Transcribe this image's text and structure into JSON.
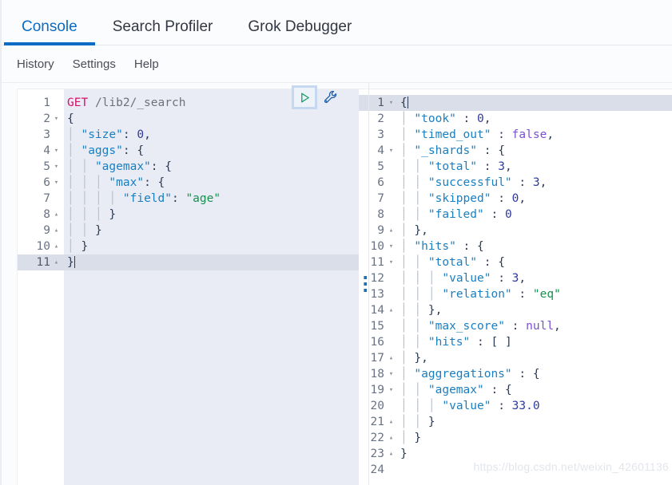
{
  "tabs": [
    {
      "label": "Console",
      "active": true
    },
    {
      "label": "Search Profiler",
      "active": false
    },
    {
      "label": "Grok Debugger",
      "active": false
    }
  ],
  "menu": [
    {
      "label": "History"
    },
    {
      "label": "Settings"
    },
    {
      "label": "Help"
    }
  ],
  "toolbar": {
    "play_icon": "play-triangle-icon",
    "wrench_icon": "wrench-icon",
    "play_title": "Click to send request",
    "wrench_title": "Open documentation / options"
  },
  "request_editor": {
    "accent_active_line": "#d9dee9",
    "background": "#e9ecf4",
    "active_line": 11,
    "lines": [
      {
        "n": 1,
        "fold": "",
        "text": "GET /lib2/_search"
      },
      {
        "n": 2,
        "fold": "▾",
        "text": "{"
      },
      {
        "n": 3,
        "fold": "",
        "text": "  \"size\": 0,"
      },
      {
        "n": 4,
        "fold": "▾",
        "text": "  \"aggs\": {"
      },
      {
        "n": 5,
        "fold": "▾",
        "text": "    \"agemax\": {"
      },
      {
        "n": 6,
        "fold": "▾",
        "text": "      \"max\": {"
      },
      {
        "n": 7,
        "fold": "",
        "text": "        \"field\": \"age\""
      },
      {
        "n": 8,
        "fold": "▴",
        "text": "      }"
      },
      {
        "n": 9,
        "fold": "▴",
        "text": "    }"
      },
      {
        "n": 10,
        "fold": "▴",
        "text": "  }"
      },
      {
        "n": 11,
        "fold": "▴",
        "text": "}"
      }
    ]
  },
  "response_editor": {
    "background": "#ffffff",
    "active_line": 1,
    "lines": [
      {
        "n": 1,
        "fold": "▾",
        "text": "{"
      },
      {
        "n": 2,
        "fold": "",
        "text": "  \"took\" : 0,"
      },
      {
        "n": 3,
        "fold": "",
        "text": "  \"timed_out\" : false,"
      },
      {
        "n": 4,
        "fold": "▾",
        "text": "  \"_shards\" : {"
      },
      {
        "n": 5,
        "fold": "",
        "text": "    \"total\" : 3,"
      },
      {
        "n": 6,
        "fold": "",
        "text": "    \"successful\" : 3,"
      },
      {
        "n": 7,
        "fold": "",
        "text": "    \"skipped\" : 0,"
      },
      {
        "n": 8,
        "fold": "",
        "text": "    \"failed\" : 0"
      },
      {
        "n": 9,
        "fold": "▴",
        "text": "  },"
      },
      {
        "n": 10,
        "fold": "▾",
        "text": "  \"hits\" : {"
      },
      {
        "n": 11,
        "fold": "▾",
        "text": "    \"total\" : {"
      },
      {
        "n": 12,
        "fold": "",
        "text": "      \"value\" : 3,"
      },
      {
        "n": 13,
        "fold": "",
        "text": "      \"relation\" : \"eq\""
      },
      {
        "n": 14,
        "fold": "▴",
        "text": "    },"
      },
      {
        "n": 15,
        "fold": "",
        "text": "    \"max_score\" : null,"
      },
      {
        "n": 16,
        "fold": "",
        "text": "    \"hits\" : [ ]"
      },
      {
        "n": 17,
        "fold": "▴",
        "text": "  },"
      },
      {
        "n": 18,
        "fold": "▾",
        "text": "  \"aggregations\" : {"
      },
      {
        "n": 19,
        "fold": "▾",
        "text": "    \"agemax\" : {"
      },
      {
        "n": 20,
        "fold": "",
        "text": "      \"value\" : 33.0"
      },
      {
        "n": 21,
        "fold": "▴",
        "text": "    }"
      },
      {
        "n": 22,
        "fold": "▴",
        "text": "  }"
      },
      {
        "n": 23,
        "fold": "▴",
        "text": "}"
      },
      {
        "n": 24,
        "fold": "",
        "text": ""
      }
    ]
  },
  "divider": {
    "grip_icon": "drag-handle-icon"
  },
  "watermark": {
    "text": "https://blog.csdn.net/weixin_42601136"
  },
  "colors": {
    "accent": "#0a6cc4",
    "method": "#d9106d",
    "string": "#18914f",
    "key": "#1a7fc1",
    "literal": "#7b4fd1",
    "number": "#2f3b9e",
    "play": "#1b9c6a"
  }
}
